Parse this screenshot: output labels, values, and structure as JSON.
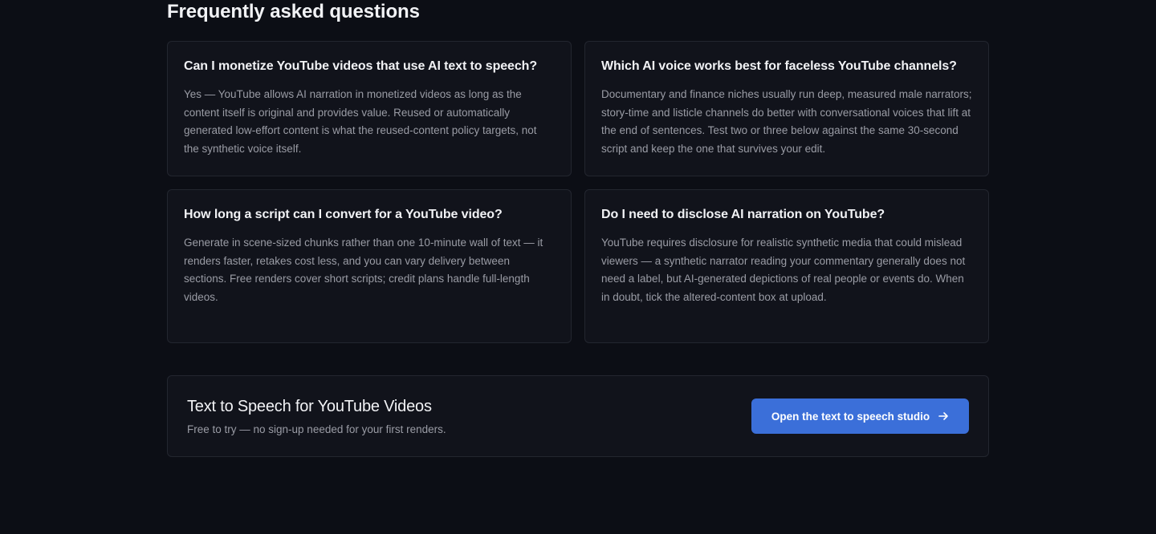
{
  "faq": {
    "title": "Frequently asked questions",
    "items": [
      {
        "question": "Can I monetize YouTube videos that use AI text to speech?",
        "answer": "Yes — YouTube allows AI narration in monetized videos as long as the content itself is original and provides value. Reused or automatically generated low-effort content is what the reused-content policy targets, not the synthetic voice itself."
      },
      {
        "question": "Which AI voice works best for faceless YouTube channels?",
        "answer": "Documentary and finance niches usually run deep, measured male narrators; story-time and listicle channels do better with conversational voices that lift at the end of sentences. Test two or three below against the same 30-second script and keep the one that survives your edit."
      },
      {
        "question": "How long a script can I convert for a YouTube video?",
        "answer": "Generate in scene-sized chunks rather than one 10-minute wall of text — it renders faster, retakes cost less, and you can vary delivery between sections. Free renders cover short scripts; credit plans handle full-length videos."
      },
      {
        "question": "Do I need to disclose AI narration on YouTube?",
        "answer": "YouTube requires disclosure for realistic synthetic media that could mislead viewers — a synthetic narrator reading your commentary generally does not need a label, but AI-generated depictions of real people or events do. When in doubt, tick the altered-content box at upload."
      }
    ]
  },
  "cta": {
    "title": "Text to Speech for YouTube Videos",
    "subtitle": "Free to try — no sign-up needed for your first renders.",
    "button_label": "Open the text to speech studio",
    "button_icon": "arrow-right-icon"
  },
  "colors": {
    "background": "#0c0e15",
    "card": "#11131b",
    "border": "#23262f",
    "accent": "#3b6fd9",
    "heading": "#f1f2f5",
    "body_text": "#9a9ca5"
  }
}
